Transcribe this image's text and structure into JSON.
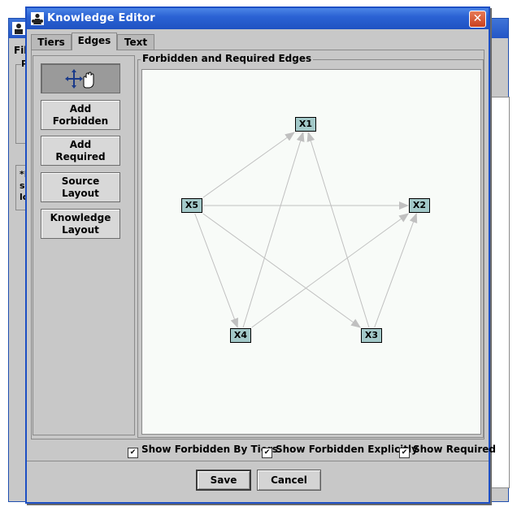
{
  "background_window": {
    "menu_label": "Fil",
    "panel1_label": "P",
    "panel2_text": "*P\nsc\nlo"
  },
  "dialog": {
    "title": "Knowledge Editor",
    "close_symbol": "✕",
    "tabs": [
      {
        "label": "Tiers",
        "active": false
      },
      {
        "label": "Edges",
        "active": true
      },
      {
        "label": "Text",
        "active": false
      }
    ]
  },
  "tools": {
    "move_tool_icon": "move-hand-icon",
    "buttons": [
      "Add\nForbidden",
      "Add\nRequired",
      "Source\nLayout",
      "Knowledge\nLayout"
    ]
  },
  "graph": {
    "group_title": "Forbidden and Required Edges",
    "nodes": [
      "X1",
      "X2",
      "X3",
      "X4",
      "X5"
    ],
    "edges": [
      [
        "X5",
        "X1"
      ],
      [
        "X5",
        "X2"
      ],
      [
        "X5",
        "X3"
      ],
      [
        "X5",
        "X4"
      ],
      [
        "X4",
        "X1"
      ],
      [
        "X4",
        "X2"
      ],
      [
        "X3",
        "X1"
      ],
      [
        "X3",
        "X2"
      ]
    ],
    "edge_color": "#c0c0c0",
    "node_color": "#a3c9c9"
  },
  "checkboxes": [
    {
      "label": "Show Forbidden By Tiers",
      "checked": true
    },
    {
      "label": "Show Forbidden Explicitly",
      "checked": true
    },
    {
      "label": "Show Required",
      "checked": true
    }
  ],
  "buttons": {
    "save": "Save",
    "cancel": "Cancel"
  },
  "colors": {
    "titlebar": "#2b62d4",
    "dialog_bg": "#c8c8c8",
    "close_button": "#d6532e"
  }
}
